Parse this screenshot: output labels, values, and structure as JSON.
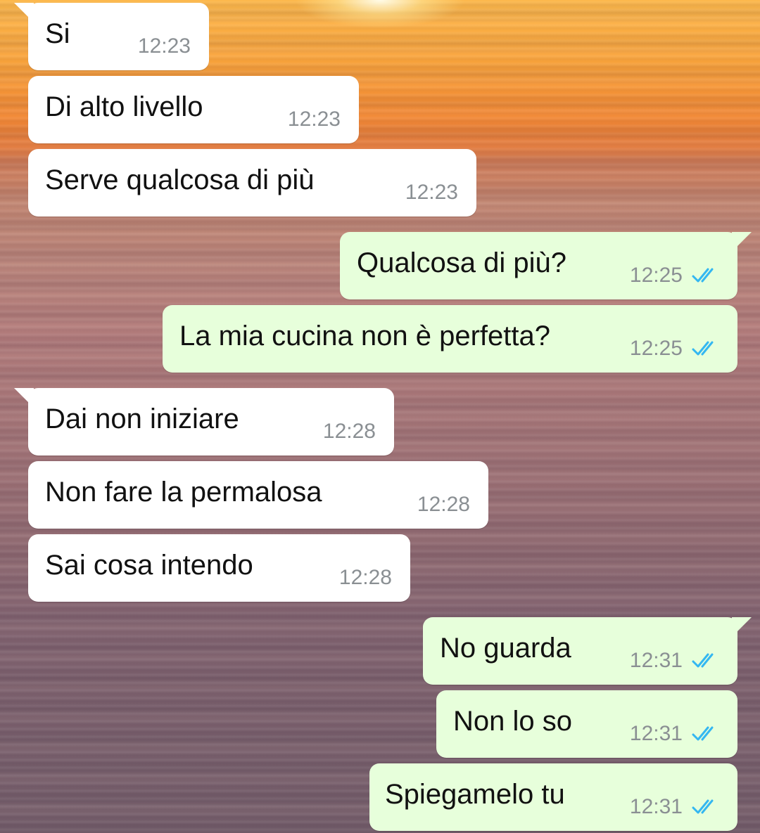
{
  "colors": {
    "incoming_bubble": "#ffffff",
    "outgoing_bubble": "#e7ffdb",
    "read_ticks": "#34b7f1",
    "timestamp": "#8a8f93"
  },
  "messages": [
    {
      "direction": "incoming",
      "text": "Si",
      "time": "12:23",
      "tail": true
    },
    {
      "direction": "incoming",
      "text": "Di alto livello",
      "time": "12:23",
      "tail": false
    },
    {
      "direction": "incoming",
      "text": "Serve qualcosa di più",
      "time": "12:23",
      "tail": false
    },
    {
      "direction": "outgoing",
      "text": "Qualcosa di più?",
      "time": "12:25",
      "status_icon": "double-check-read-icon",
      "tail": true
    },
    {
      "direction": "outgoing",
      "text": "La mia cucina non è perfetta?",
      "time": "12:25",
      "status_icon": "double-check-read-icon",
      "tail": false
    },
    {
      "direction": "incoming",
      "text": "Dai non iniziare",
      "time": "12:28",
      "tail": true
    },
    {
      "direction": "incoming",
      "text": "Non fare la permalosa",
      "time": "12:28",
      "tail": false
    },
    {
      "direction": "incoming",
      "text": "Sai cosa intendo",
      "time": "12:28",
      "tail": false
    },
    {
      "direction": "outgoing",
      "text": "No guarda",
      "time": "12:31",
      "status_icon": "double-check-read-icon",
      "tail": true
    },
    {
      "direction": "outgoing",
      "text": "Non lo so",
      "time": "12:31",
      "status_icon": "double-check-read-icon",
      "tail": false
    },
    {
      "direction": "outgoing",
      "text": "Spiegamelo tu",
      "time": "12:31",
      "status_icon": "double-check-read-icon",
      "tail": false
    }
  ]
}
